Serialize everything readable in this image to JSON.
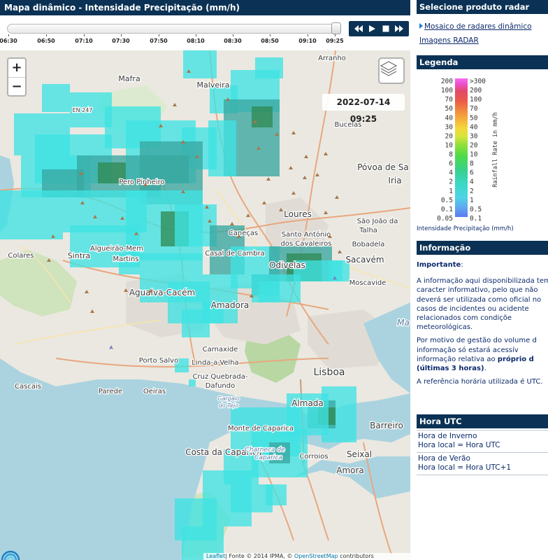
{
  "header": {
    "title": "Mapa dinâmico - Intensidade Precipitação (mm/h)"
  },
  "timeline": {
    "ticks": [
      "06:30",
      "06:50",
      "07:10",
      "07:30",
      "07:50",
      "08:10",
      "08:30",
      "08:50",
      "09:10",
      "09:25"
    ],
    "position": 1.0
  },
  "controls": {
    "rewind_icon": "rewind-icon",
    "play_icon": "play-icon",
    "stop_icon": "stop-icon",
    "forward_icon": "fast-forward-icon"
  },
  "map": {
    "zoom_in": "+",
    "zoom_out": "−",
    "timestamp": "2022-07-14 09:25",
    "attribution": {
      "leaflet": "Leaflet",
      "fonte": "| Fonte © 2014 IPMA, © ",
      "osm": "OpenStreetMap",
      "contributors": " contributors"
    },
    "places": [
      "Arranho",
      "Mafra",
      "Malveira",
      "Bucelas",
      "Póvoa de Sa",
      "Iria",
      "EN 247",
      "Pero Pinheiro",
      "Loures",
      "Santo António",
      "dos Cavaleiros",
      "São João da",
      "Talha",
      "Bobadela",
      "Caneças",
      "Casal de Cambra",
      "Colares",
      "Sintra",
      "Algueirão-Mem",
      "Martins",
      "Odivelas",
      "Sacavém",
      "Moscavide",
      "Agualva-Cacém",
      "Amadora",
      "Carnaxide",
      "Porto Salvo",
      "Linda-a-Velha",
      "Cruz Quebrada-",
      "Dafundo",
      "Cascais",
      "Parede",
      "Oeiras",
      "Gargalo",
      "do Tejo",
      "Lisboa",
      "Almada",
      "Monte de Caparica",
      "Costa da Caparica",
      "Charneca de",
      "Caparica",
      "Corroios",
      "Seixal",
      "Barreiro",
      "Amora",
      "Ma"
    ]
  },
  "sidebar": {
    "radar_title": "Selecione produto radar",
    "link_mosaic": "Mosaico de radares dinâmico",
    "link_images": "Imagens RADAR",
    "legend_title": "Legenda",
    "legend_left": [
      "200",
      "100",
      "70",
      "50",
      "40",
      "30",
      "20",
      "10",
      "8",
      "6",
      "4",
      "2",
      "1",
      "0.5",
      "0.1",
      "0.05"
    ],
    "legend_right": [
      ">300",
      "200",
      "100",
      "70",
      "50",
      "40",
      "30",
      "20",
      "10",
      "8",
      "6",
      "4",
      "2",
      "1",
      "0.5",
      "0.1"
    ],
    "legend_axis": "Rainfall Rate in mm/h",
    "legend_caption": "Intensidade Precipitação (mm/h)",
    "info_title": "Informação",
    "info_important": "Importante",
    "info_colon": ":",
    "info_p1": [
      "A informação aqui disponibilizada tem",
      "caracter informativo, pelo que não",
      "deverá ser utilizada como oficial no",
      "casos de incidentes ou acidente",
      "relacionados        com        condiçõe",
      "meteorológicas."
    ],
    "info_p2_lines": [
      "Por motivo de gestão do volume d",
      "informação    só    estará    acessív"
    ],
    "info_p2_l3_pre": "informação relativa ao ",
    "info_p2_l3_bold": "próprio d",
    "info_p2_l4_bold": "(últimas 3 horas)",
    "info_p2_l4_post": ".",
    "info_p3": "A referência horária utilizada é UTC.",
    "hora_title": "Hora UTC",
    "winter_label": "Hora de Inverno",
    "winter_value": "Hora local = Hora UTC",
    "summer_label": "Hora de Verão",
    "summer_value": "Hora local = Hora UTC+1"
  },
  "colors": {
    "header_bg": "#0b3255",
    "radar_light": "#3fe3e3",
    "radar_mid": "#3aa7a0",
    "radar_dark": "#2f8a55",
    "link": "#0b2a6b"
  }
}
